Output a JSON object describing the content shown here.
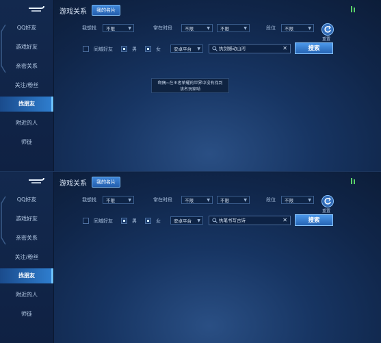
{
  "panels": [
    {
      "sidebar": {
        "items": [
          "QQ好友",
          "游戏好友",
          "亲密关系",
          "关注/粉丝",
          "找朋友",
          "附近的人",
          "师徒"
        ],
        "active_index": 4
      },
      "header": {
        "title": "游戏关系",
        "card_button": "我的名片"
      },
      "filters": {
        "want_label": "我想找",
        "want_value": "不限",
        "time_label": "常在时段",
        "time_start": "不限",
        "time_end": "不限",
        "rank_label": "段位",
        "rank_value": "不限",
        "reset_label": "重置"
      },
      "options": {
        "same_city": "同城好友",
        "male": "男",
        "female": "女",
        "platform": "安卓平台"
      },
      "search": {
        "query": "执剑撼动山河",
        "button": "搜索"
      },
      "toast": {
        "line1": "啊偶~在王者荣耀的世界中没有找到",
        "line2": "该名玩家呦"
      }
    },
    {
      "sidebar": {
        "items": [
          "QQ好友",
          "游戏好友",
          "亲密关系",
          "关注/粉丝",
          "找朋友",
          "附近的人",
          "师徒"
        ],
        "active_index": 4
      },
      "header": {
        "title": "游戏关系",
        "card_button": "我的名片"
      },
      "filters": {
        "want_label": "我想找",
        "want_value": "不限",
        "time_label": "常在时段",
        "time_start": "不限",
        "time_end": "不限",
        "rank_label": "段位",
        "rank_value": "不限",
        "reset_label": "重置"
      },
      "options": {
        "same_city": "同城好友",
        "male": "男",
        "female": "女",
        "platform": "安卓平台"
      },
      "search": {
        "query": "执笔书写古诗",
        "button": "搜索"
      }
    }
  ],
  "icons": {
    "back": "back-arrow-icon",
    "reset": "refresh-icon",
    "search": "search-icon",
    "clear": "close-icon",
    "corner": "music-note-icon"
  },
  "colors": {
    "accent": "#2f7fd0",
    "background": "#10264a",
    "button": "#2563b3"
  }
}
